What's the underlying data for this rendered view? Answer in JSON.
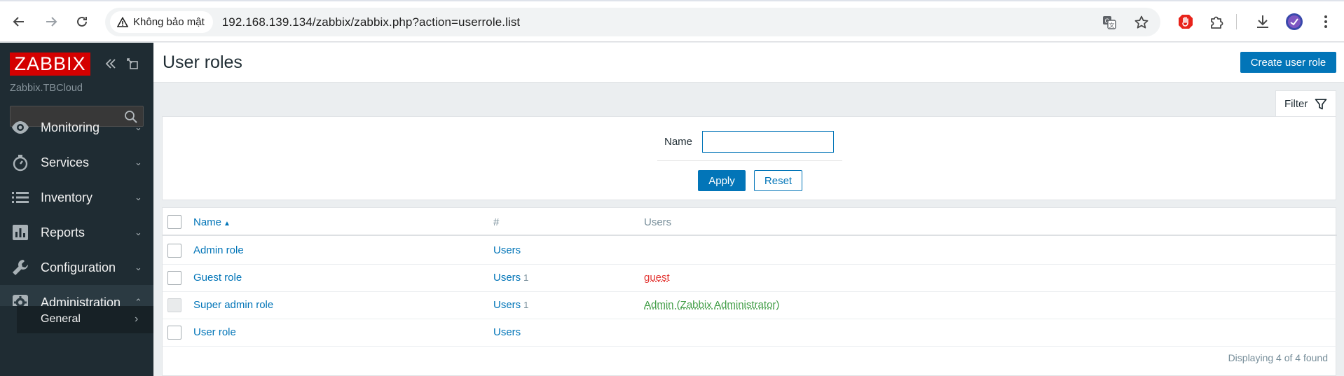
{
  "browser": {
    "security_label": "Không bảo mật",
    "url": "192.168.139.134/zabbix/zabbix.php?action=userrole.list"
  },
  "sidebar": {
    "logo": "ZABBIX",
    "server_name": "Zabbix.TBCloud",
    "search_value": "",
    "items": [
      {
        "label": "Monitoring",
        "icon": "eye-icon"
      },
      {
        "label": "Services",
        "icon": "stopwatch-icon"
      },
      {
        "label": "Inventory",
        "icon": "list-icon"
      },
      {
        "label": "Reports",
        "icon": "bar-chart-icon"
      },
      {
        "label": "Configuration",
        "icon": "wrench-icon"
      },
      {
        "label": "Administration",
        "icon": "gear-icon"
      }
    ],
    "submenu": {
      "label": "General"
    }
  },
  "header": {
    "title": "User roles",
    "create_button": "Create user role"
  },
  "filter": {
    "tab_label": "Filter",
    "name_label": "Name",
    "name_value": "",
    "apply_label": "Apply",
    "reset_label": "Reset"
  },
  "table": {
    "columns": {
      "name": "Name",
      "count": "#",
      "users": "Users"
    },
    "rows": [
      {
        "name": "Admin role",
        "users_link": "Users",
        "count": "",
        "users": "",
        "users_color": ""
      },
      {
        "name": "Guest role",
        "users_link": "Users",
        "count": "1",
        "users": "guest",
        "users_color": "red"
      },
      {
        "name": "Super admin role",
        "users_link": "Users",
        "count": "1",
        "users": "Admin (Zabbix Administrator)",
        "users_color": "green"
      },
      {
        "name": "User role",
        "users_link": "Users",
        "count": "",
        "users": "",
        "users_color": ""
      }
    ],
    "footer": "Displaying 4 of 4 found"
  },
  "colors": {
    "sidebar_bg": "#1f2c33",
    "accent": "#0275b8",
    "logo_red": "#d40000",
    "user_red": "#e33734",
    "user_green": "#429e47"
  }
}
